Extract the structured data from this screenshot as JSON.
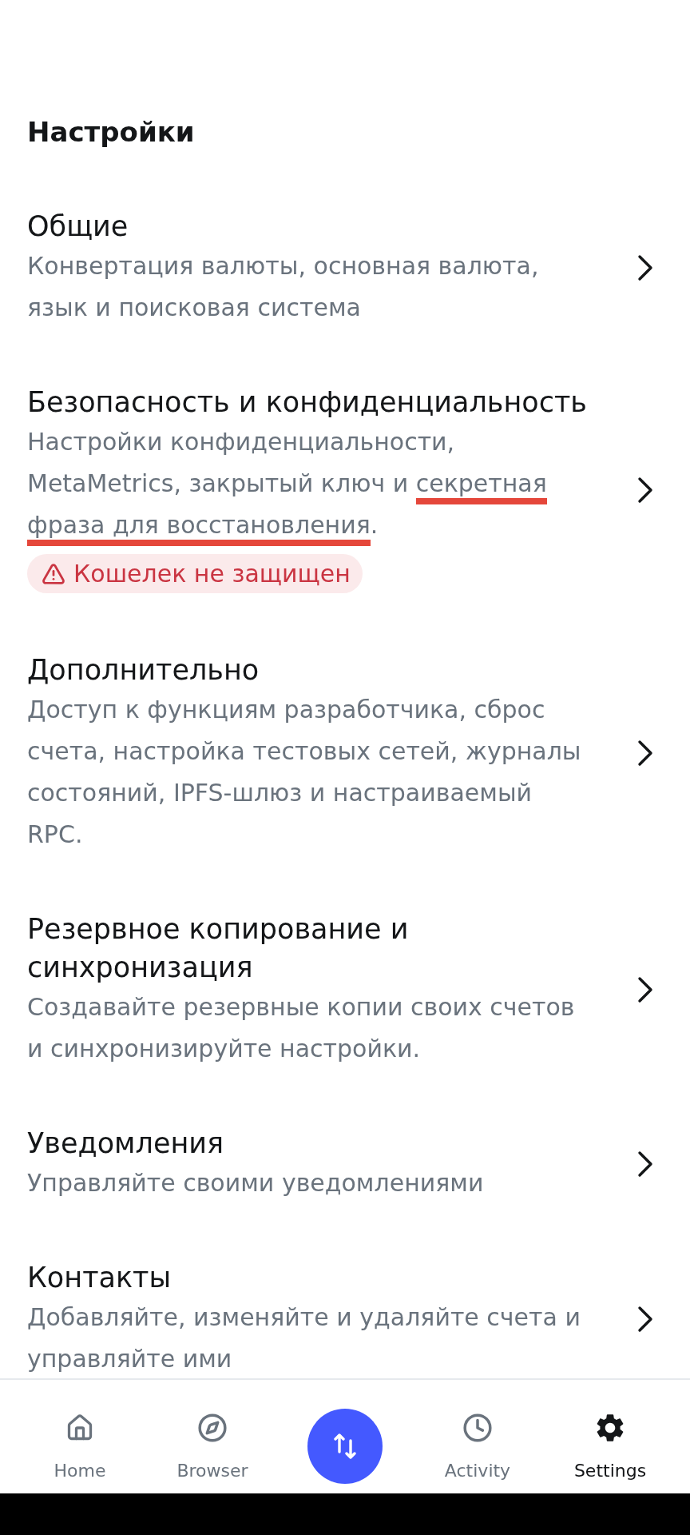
{
  "header": {
    "title": "Настройки"
  },
  "sections": [
    {
      "title": "Общие",
      "description": [
        {
          "text": "Конвертация валюты, основная валюта, язык и поисковая система",
          "underlined": false
        }
      ]
    },
    {
      "title": "Безопасность и конфиденциальность",
      "description": [
        {
          "text": "Настройки конфиденциальности, MetaMetrics, закрытый ключ и ",
          "underlined": false
        },
        {
          "text": "секретная фраза для восстановления",
          "underlined": true
        },
        {
          "text": ".",
          "underlined": false
        }
      ],
      "badge": {
        "kind": "warning",
        "text": "Кошелек не защищен"
      }
    },
    {
      "title": "Дополнительно",
      "description": [
        {
          "text": "Доступ к функциям разработчика, сброс счета, настройка тестовых сетей, журналы состояний, IPFS-шлюз и настраиваемый RPC.",
          "underlined": false
        }
      ]
    },
    {
      "title": "Резервное копирование и синхронизация",
      "description": [
        {
          "text": "Создавайте резервные копии своих счетов и синхронизируйте настройки.",
          "underlined": false
        }
      ]
    },
    {
      "title": "Уведомления",
      "description": [
        {
          "text": "Управляйте своими уведомлениями",
          "underlined": false
        }
      ]
    },
    {
      "title": "Контакты",
      "description": [
        {
          "text": "Добавляйте, изменяйте и удаляйте счета и управляйте ими",
          "underlined": false
        }
      ]
    }
  ],
  "nav": {
    "items": [
      {
        "kind": "tab",
        "label": "Home",
        "selected": false
      },
      {
        "kind": "tab",
        "label": "Browser",
        "selected": false
      },
      {
        "kind": "action"
      },
      {
        "kind": "tab",
        "label": "Activity",
        "selected": false
      },
      {
        "kind": "tab",
        "label": "Settings",
        "selected": true
      }
    ]
  }
}
